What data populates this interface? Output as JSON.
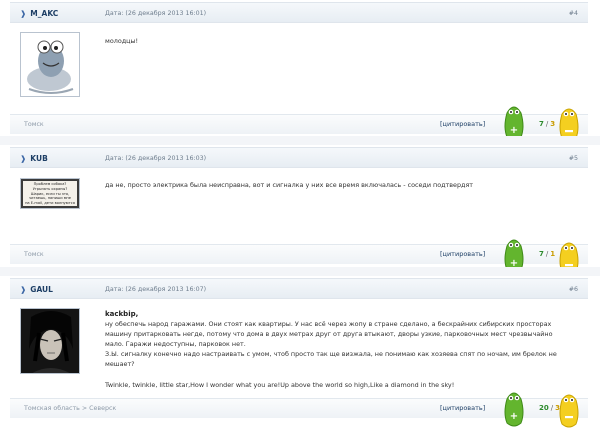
{
  "posts": [
    {
      "author": "M_AKC",
      "date": "Дата: (26 декабря 2013 16:01)",
      "number": "#4",
      "lines": [
        "молодцы!"
      ],
      "location": "Томск",
      "quote": "[цитировать]",
      "rating_pos": "7",
      "rating_neg": "3"
    },
    {
      "author": "KUB",
      "date": "Дата: (26 декабря 2013 16:03)",
      "number": "#5",
      "lines": [
        "да не, просто электрика была неисправна, вот и сигналка у них все время включалась - соседи подтвердят"
      ],
      "location": "Томск",
      "quote": "[цитировать]",
      "rating_pos": "7",
      "rating_neg": "1",
      "avatar_text": [
        "Проблем собака?",
        "Угрызать охраны?",
        "Шарик, если ты это,",
        "читаешь, напиши мне",
        "на E-mail, дети волнуются"
      ]
    },
    {
      "author": "GAUL",
      "date": "Дата: (26 декабря 2013 16:07)",
      "number": "#6",
      "quote_author": "kackbip,",
      "lines": [
        "ну обеспечь народ гаражами. Они стоят как квартиры. У нас всё через жопу в стране сделано, а бескрайних сибирских просторах",
        "машину притарковать негде, потому что дома в двух метрах друг от друга втыкают, дворы узкие, парковочных мест чрезвычайно",
        "мало. Гаражи недоступны, парковок нет.",
        "З.Ы. сигналку конечно надо настраивать с умом, чтоб просто так ще визжала, не понимаю как хозяева спят по ночам, им брелок не",
        "мешает?"
      ],
      "extra_line": "Twinkle, twinkle, little star,How I wonder what you are!Up above the world so high,Like a diamond in the sky!",
      "location": "Томская область > Северск",
      "quote": "[цитировать]",
      "rating_pos": "20",
      "rating_neg": "3"
    }
  ],
  "colors": {
    "positive": "#2c8a2c",
    "negative": "#c89b00",
    "author": "#1e3f66"
  },
  "icons": {
    "vote_up": "green-plus-blob-icon",
    "vote_down": "yellow-minus-blob-icon",
    "author_marker": "arrow-right-icon"
  }
}
